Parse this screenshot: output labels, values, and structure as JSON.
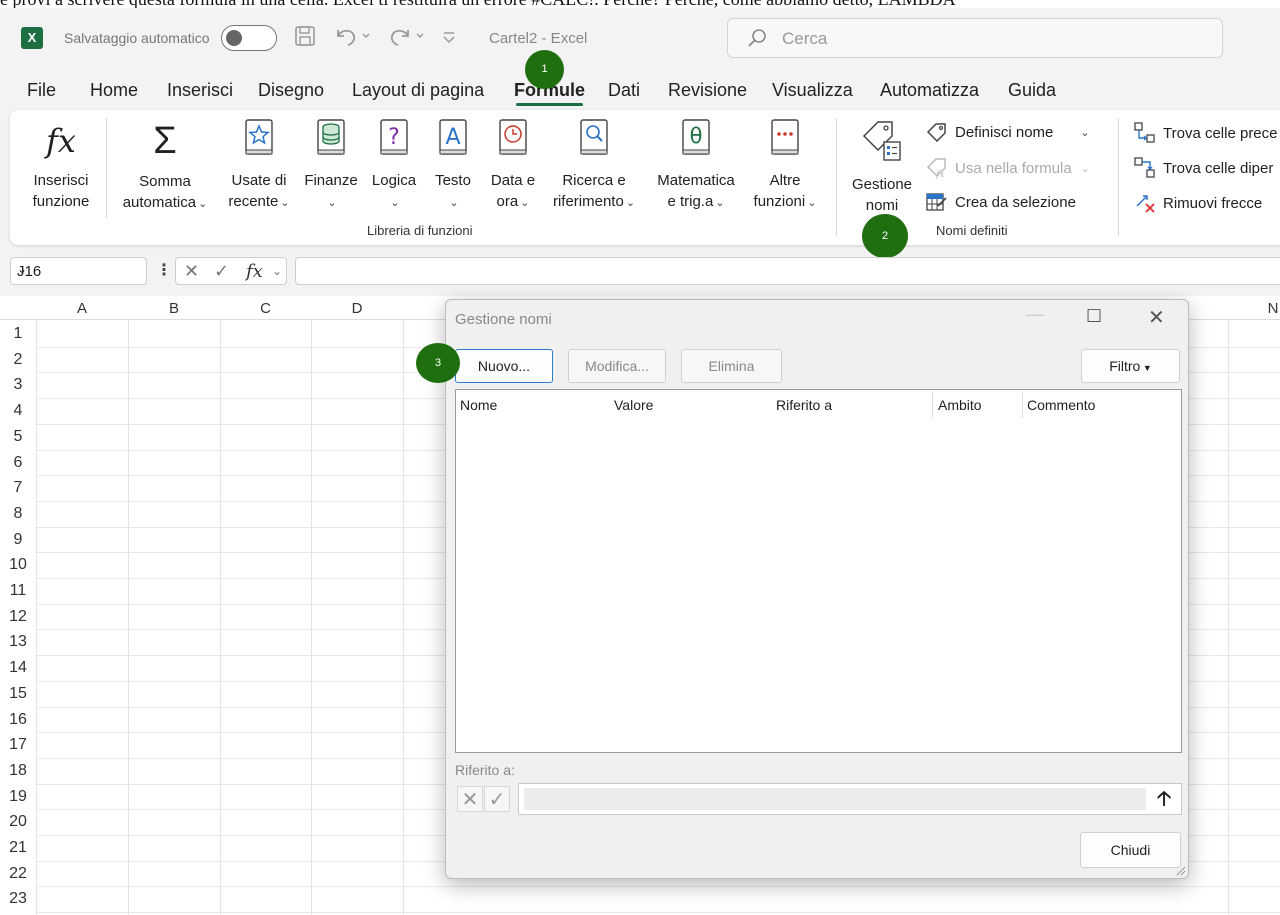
{
  "top_text": "e provi a scrivere questa formula in una cella. Excel ti restituirà un errore #CALC!. Perché? Perché, come abbiamo detto, LAMBDA",
  "titlebar": {
    "logo": "X",
    "autosave_label": "Salvataggio automatico",
    "doc_title": "Cartel2  -  Excel",
    "search_placeholder": "Cerca",
    "icons": [
      "save-icon",
      "undo-icon",
      "redo-icon",
      "customize-icon"
    ]
  },
  "tabs": [
    "File",
    "Home",
    "Inserisci",
    "Disegno",
    "Layout di pagina",
    "Formule",
    "Dati",
    "Revisione",
    "Visualizza",
    "Automatizza",
    "Guida"
  ],
  "active_tab": "Formule",
  "accent_color": "#1d6f42",
  "ribbon": {
    "insert_function": {
      "line1": "Inserisci",
      "line2": "funzione"
    },
    "library": [
      {
        "line1": "Somma",
        "line2": "automatica",
        "dropdown": true
      },
      {
        "line1": "Usate di",
        "line2": "recente",
        "dropdown": true
      },
      {
        "line1": "Finanze",
        "line2": "",
        "dropdown": true
      },
      {
        "line1": "Logica",
        "line2": "",
        "dropdown": true
      },
      {
        "line1": "Testo",
        "line2": "",
        "dropdown": true
      },
      {
        "line1": "Data e",
        "line2": "ora",
        "dropdown": true
      },
      {
        "line1": "Ricerca e",
        "line2": "riferimento",
        "dropdown": true
      },
      {
        "line1": "Matematica",
        "line2": "e trig.a",
        "dropdown": true
      },
      {
        "line1": "Altre",
        "line2": "funzioni",
        "dropdown": true
      }
    ],
    "library_group_label": "Libreria di funzioni",
    "name_manager": {
      "line1": "Gestione",
      "line2": "nomi"
    },
    "define_name": "Definisci nome",
    "use_in_formula": "Usa nella formula",
    "create_from_selection": "Crea da selezione",
    "names_group_label": "Nomi definiti",
    "trace_precedents": "Trova celle prece",
    "trace_dependents": "Trova celle diper",
    "remove_arrows": "Rimuovi frecce"
  },
  "markers": [
    "1",
    "2",
    "3"
  ],
  "marker_color": "#1f6e0f",
  "formula_bar": {
    "name_box": "J16",
    "fx": "fx"
  },
  "grid": {
    "columns": [
      "A",
      "B",
      "C",
      "D",
      "N"
    ],
    "rows": [
      "1",
      "2",
      "3",
      "4",
      "5",
      "6",
      "7",
      "8",
      "9",
      "10",
      "11",
      "12",
      "13",
      "14",
      "15",
      "16",
      "17",
      "18",
      "19",
      "20",
      "21",
      "22",
      "23"
    ]
  },
  "dialog": {
    "title": "Gestione nomi",
    "new_button": "Nuovo...",
    "edit_button": "Modifica...",
    "delete_button": "Elimina",
    "filter_button": "Filtro",
    "columns": [
      "Nome",
      "Valore",
      "Riferito a",
      "Ambito",
      "Commento"
    ],
    "refers_to_label": "Riferito a:",
    "close_button": "Chiudi"
  }
}
